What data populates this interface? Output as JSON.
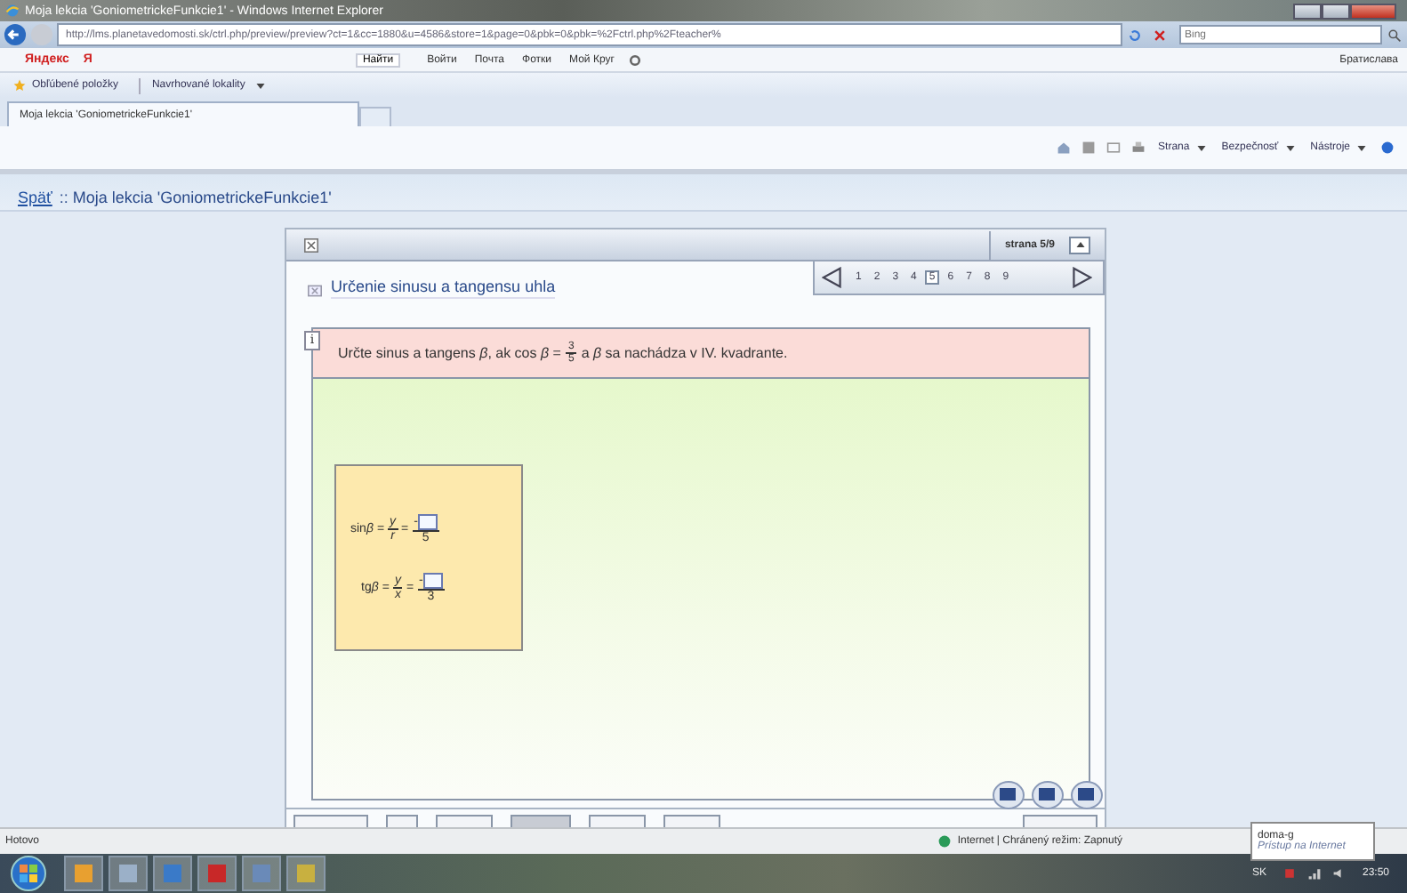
{
  "window": {
    "title": "Moja lekcia 'GoniometrickeFunkcie1' - Windows Internet Explorer"
  },
  "address_bar": {
    "url": "http://lms.planetavedomosti.sk/ctrl.php/preview/preview?ct=1&cc=1880&u=4586&store=1&page=0&pbk=0&pbk=%2Fctrl.php%2Fteacher%",
    "search_placeholder": "Bing"
  },
  "yandex_toolbar": {
    "logo": "Яндекс",
    "menu": "Я",
    "search_button": "Найти",
    "links": [
      "Войти",
      "Почта",
      "Фотки",
      "Мой Круг"
    ],
    "city": "Братислава"
  },
  "favorites_bar": {
    "favorites": "Obľúbené položky",
    "suggested": "Navrhované lokality"
  },
  "tabs": [
    {
      "label": "Moja lekcia 'GoniometrickeFunkcie1'",
      "selected": true
    }
  ],
  "command_bar": [
    "Strana",
    "Bezpečnosť",
    "Nástroje"
  ],
  "breadcrumb": {
    "back": "Späť",
    "title": ":: Moja lekcia 'GoniometrickeFunkcie1'"
  },
  "lesson": {
    "page_label": "strana  5/9",
    "pages": [
      {
        "label": "1",
        "selected": false
      },
      {
        "label": "2",
        "selected": false
      },
      {
        "label": "3",
        "selected": false
      },
      {
        "label": "4",
        "selected": false
      },
      {
        "label": "5",
        "selected": true
      },
      {
        "label": "6",
        "selected": false
      },
      {
        "label": "7",
        "selected": false
      },
      {
        "label": "8",
        "selected": false
      },
      {
        "label": "9",
        "selected": false
      }
    ],
    "title": "Určenie sinusu a tangensu uhla",
    "task": {
      "before": "Určte sinus a tangens *β*, ak cos *β* =",
      "num": "3",
      "den": "5",
      "after": "a *β* sa nachádza v IV. kvadrante."
    },
    "info_mark": "i",
    "equations": [
      {
        "fn": "sin",
        "var": "β",
        "equals_1": "=",
        "ratio_num": "y",
        "ratio_den": "r",
        "equals_2": "=",
        "sign": "-",
        "den": "5"
      },
      {
        "fn": "tg",
        "var": "β",
        "equals_1": "=",
        "ratio_num": "y",
        "ratio_den": "x",
        "equals_2": "=",
        "sign": "-",
        "den": "3"
      }
    ]
  },
  "status_bar": {
    "status": "Hotovo",
    "zone": "Internet | Chránený režim: Zapnutý"
  },
  "tooltip": {
    "title": "doma-g",
    "text": "Prístup na Internet"
  },
  "taskbar": {
    "language": "SK",
    "clock": "23:50"
  }
}
